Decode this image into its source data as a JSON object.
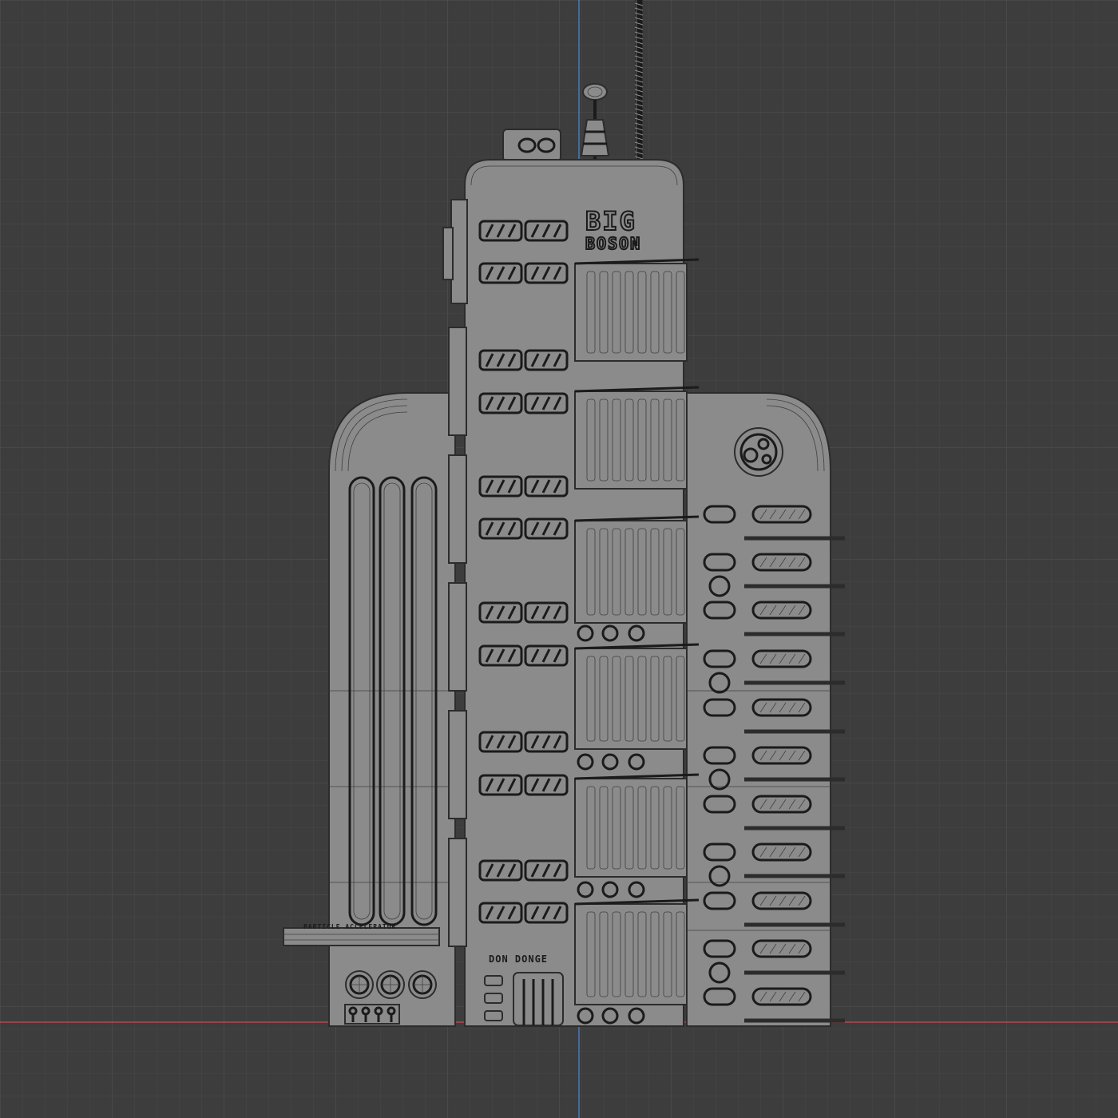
{
  "viewport": {
    "background_color": "#3d3d3d",
    "grid_minor_color": "#474747",
    "grid_major_color": "#525252",
    "axis_x_color": "#b4464f",
    "axis_y_color": "#4a7ab6",
    "object_color": "#8b8b8b",
    "wire_color": "#2c2c2c"
  },
  "model": {
    "name": "building",
    "signs": {
      "logo_top": "BIG",
      "logo_bottom": "BOSON",
      "particle_plate": "PARTICLE ACCELERATOR",
      "entrance_plate": "DON DONGE"
    }
  }
}
